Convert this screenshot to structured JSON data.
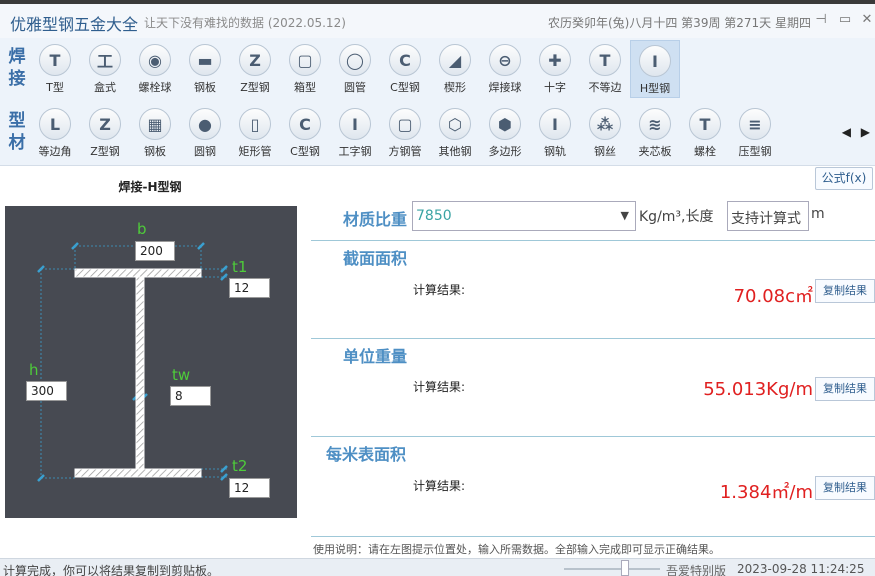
{
  "window": {
    "title": "优雅型钢五金大全",
    "subtitle": "让天下没有难找的数据 (2022.05.12)",
    "date_info": "农历癸卯年(兔)八月十四 第39周 第271天 星期四",
    "pin_icon": "pin-icon",
    "minimize_icon": "minimize-icon",
    "close_icon": "close-icon"
  },
  "toolbar": {
    "row1_label_a": "焊",
    "row1_label_b": "接",
    "row2_label_a": "型",
    "row2_label_b": "材",
    "row1": [
      {
        "label": "T型",
        "glyph": "T"
      },
      {
        "label": "盒式",
        "glyph": "工"
      },
      {
        "label": "螺栓球",
        "glyph": "◉"
      },
      {
        "label": "钢板",
        "glyph": "▬"
      },
      {
        "label": "Z型钢",
        "glyph": "Z"
      },
      {
        "label": "箱型",
        "glyph": "▢"
      },
      {
        "label": "圆管",
        "glyph": "◯"
      },
      {
        "label": "C型钢",
        "glyph": "C"
      },
      {
        "label": "楔形",
        "glyph": "◢"
      },
      {
        "label": "焊接球",
        "glyph": "⊖"
      },
      {
        "label": "十字",
        "glyph": "✚"
      },
      {
        "label": "不等边",
        "glyph": "T"
      },
      {
        "label": "H型钢",
        "glyph": "I"
      }
    ],
    "row2": [
      {
        "label": "等边角",
        "glyph": "L"
      },
      {
        "label": "Z型钢",
        "glyph": "Z"
      },
      {
        "label": "钢板",
        "glyph": "▦"
      },
      {
        "label": "圆钢",
        "glyph": "●"
      },
      {
        "label": "矩形管",
        "glyph": "▯"
      },
      {
        "label": "C型钢",
        "glyph": "C"
      },
      {
        "label": "工字钢",
        "glyph": "I"
      },
      {
        "label": "方钢管",
        "glyph": "▢"
      },
      {
        "label": "其他钢",
        "glyph": "⬡"
      },
      {
        "label": "多边形",
        "glyph": "⬢"
      },
      {
        "label": "钢轨",
        "glyph": "I"
      },
      {
        "label": "钢丝",
        "glyph": "⁂"
      },
      {
        "label": "夹芯板",
        "glyph": "≋"
      },
      {
        "label": "螺栓",
        "glyph": "T"
      },
      {
        "label": "压型钢",
        "glyph": "≡"
      }
    ],
    "nav_arrows": "◀ ▶"
  },
  "formula_button": "公式f(x)",
  "diagram": {
    "title": "焊接-H型钢",
    "label_b": "b",
    "label_t1": "t1",
    "label_h": "h",
    "label_tw": "tw",
    "label_t2": "t2",
    "b_value": "200",
    "t1_value": "12",
    "h_value": "300",
    "tw_value": "8",
    "t2_value": "12"
  },
  "density": {
    "label": "材质比重",
    "value": "7850",
    "unit_length_label": "Kg/m³,长度",
    "length_placeholder": "支持计算式",
    "length_unit": "m"
  },
  "sections": {
    "area": {
      "title": "截面面积",
      "calc_label": "计算结果:",
      "result": "70.08c㎡",
      "copy": "复制结果"
    },
    "weight": {
      "title": "单位重量",
      "calc_label": "计算结果:",
      "result": "55.013Kg/m",
      "copy": "复制结果"
    },
    "surface": {
      "title": "每米表面积",
      "calc_label": "计算结果:",
      "result": "1.384㎡/m",
      "copy": "复制结果"
    }
  },
  "usage_note": "使用说明：请在左图提示位置处，输入所需数据。全部输入完成即可显示正确结果。",
  "status": {
    "message": "计算完成，你可以将结果复制到剪贴板。",
    "brand": "吾爱特别版",
    "datetime": "2023-09-28 11:24:25"
  },
  "colors": {
    "accent_blue": "#4e8fc4",
    "result_red": "#e02020",
    "diagram_bg": "#474a52",
    "label_green": "#4ecb3a"
  }
}
